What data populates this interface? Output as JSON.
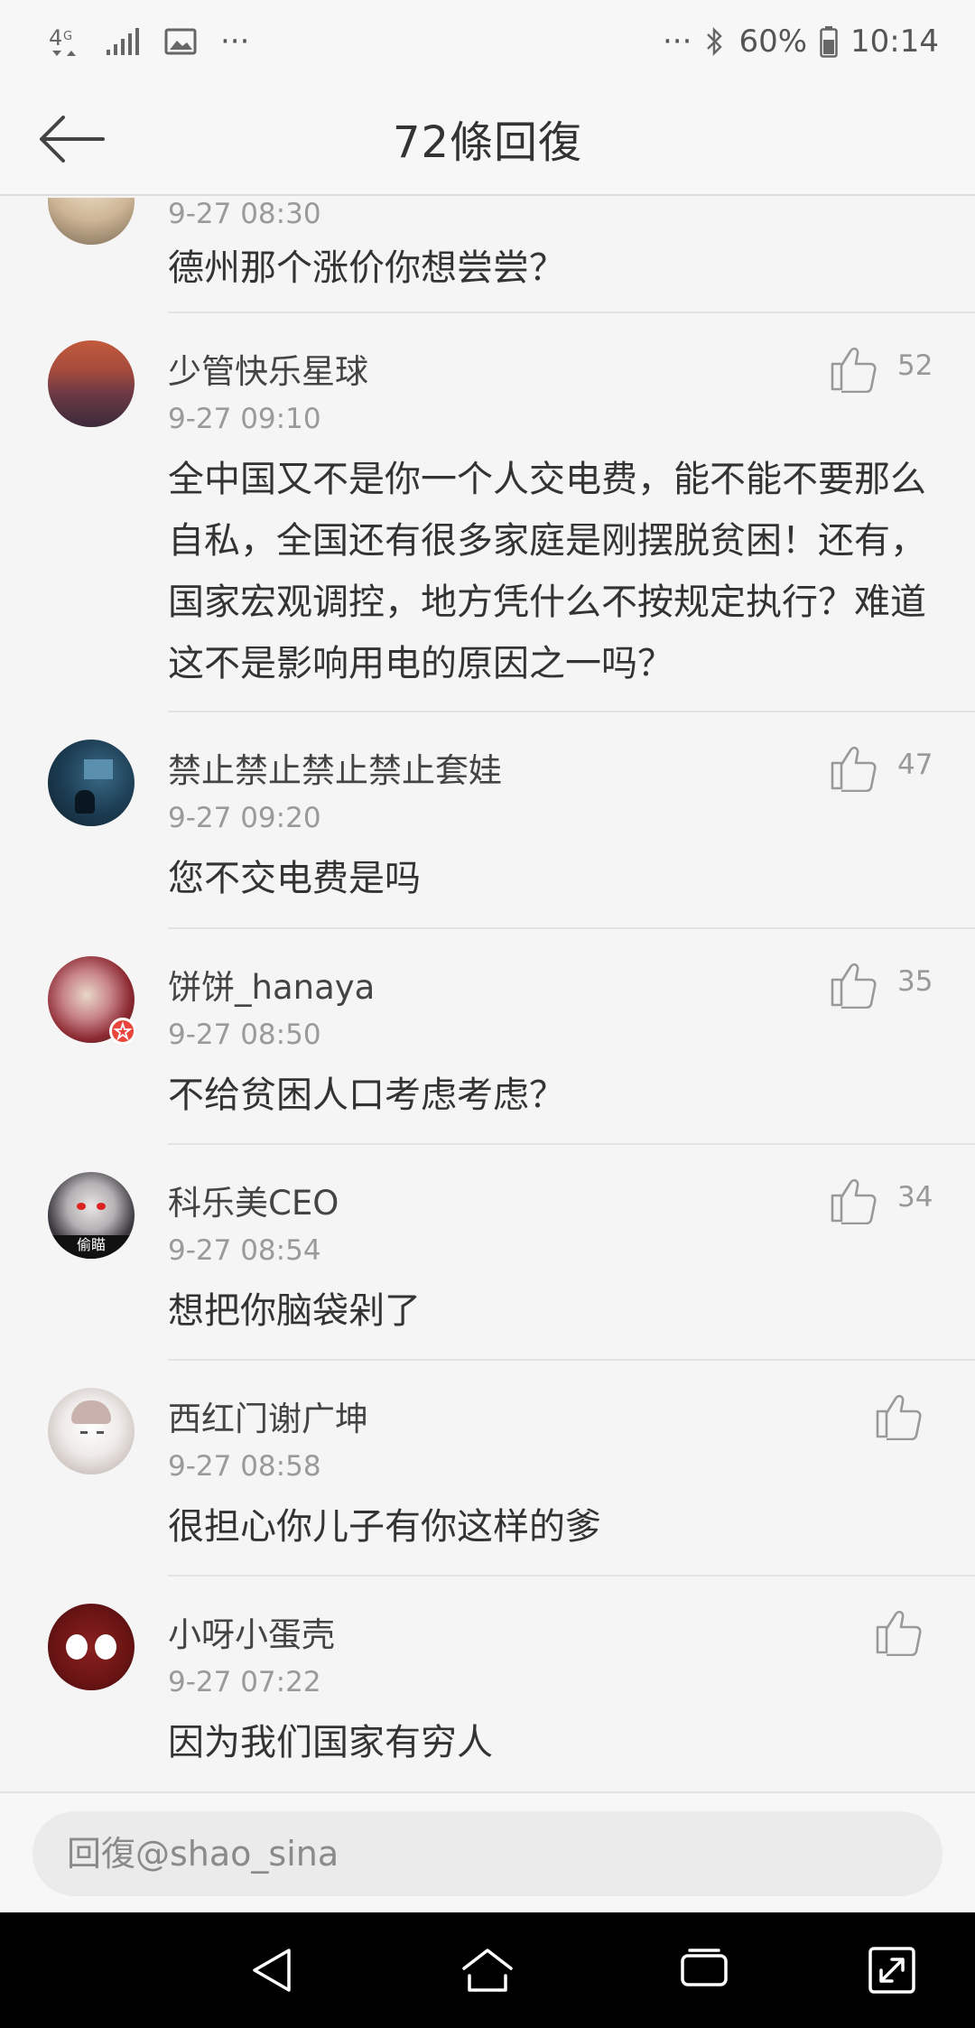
{
  "status_bar": {
    "network": "4G",
    "more_dots": "···",
    "battery": "60%",
    "time": "10:14"
  },
  "header": {
    "title": "72條回復"
  },
  "comments": [
    {
      "time": "9-27 08:30",
      "text": "德州那个涨价你想尝尝？"
    },
    {
      "user": "少管快乐星球",
      "time": "9-27 09:10",
      "likes": "52",
      "text": "全中国又不是你一个人交电费，能不能不要那么自私，全国还有很多家庭是刚摆脱贫困！还有，国家宏观调控，地方凭什么不按规定执行？难道这不是影响用电的原因之一吗？"
    },
    {
      "user": "禁止禁止禁止禁止套娃",
      "time": "9-27 09:20",
      "likes": "47",
      "text": "您不交电费是吗"
    },
    {
      "user": "饼饼_hanaya",
      "time": "9-27 08:50",
      "likes": "35",
      "text": "不给贫困人口考虑考虑？"
    },
    {
      "user": "科乐美CEO",
      "time": "9-27 08:54",
      "likes": "34",
      "text": "想把你脑袋剁了",
      "avatar_badge": "偷瞄"
    },
    {
      "user": "西红门谢广坤",
      "time": "9-27 08:58",
      "text": "很担心你儿子有你这样的爹"
    },
    {
      "user": "小呀小蛋壳",
      "time": "9-27 07:22",
      "text": "因为我们国家有穷人"
    }
  ],
  "reply": {
    "placeholder": "回復@shao_sina"
  },
  "colors": {
    "background": "#f5f5f5",
    "navbar": "#000000",
    "divider": "#e3e3e3"
  }
}
